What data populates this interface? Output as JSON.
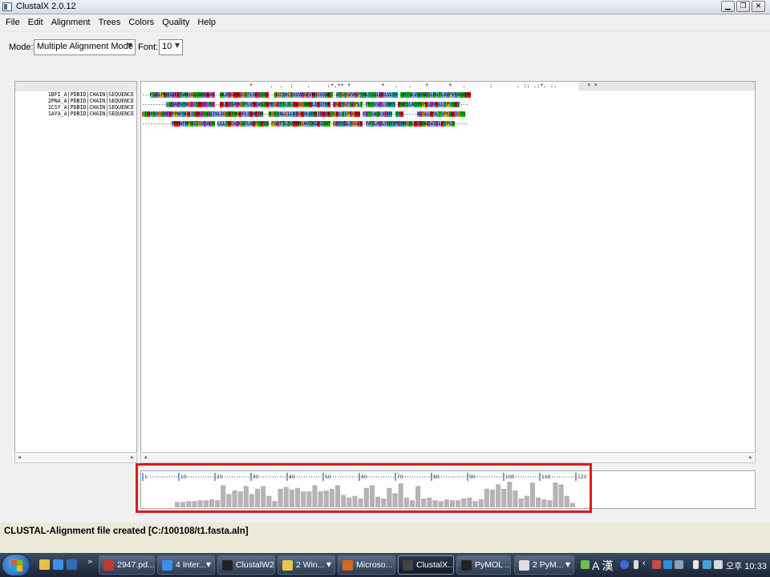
{
  "window": {
    "title": "ClustalX 2.0.12"
  },
  "menu": [
    "File",
    "Edit",
    "Alignment",
    "Trees",
    "Colors",
    "Quality",
    "Help"
  ],
  "toolbar": {
    "mode_label": "Mode:",
    "mode_value": "Multiple Alignment Mode",
    "font_label": "Font:",
    "font_value": "10"
  },
  "alignment": {
    "consensus": "                                *     .  .  :    .     :*.** *         *   .   .    *      *   .       :       . :: .:*. :.         * *",
    "sequences": [
      {
        "name": "1BFI_A|PDBID|CHAIN|SEQUENCE",
        "residues": "---MSDLPKHIDEKTWNVGSSNHDKAE--NLAEGKRDGTFLVRESSK--QGCYACSVVVDGEVKHCVINKT-ATGYGFAEPYNLYSSLKELVLHY-QHTSLVQHNDSLNVTLAYPVYAQQRR"
      },
      {
        "name": "2PNA_A|PDBID|CHAIN|SEQUENCE",
        "residues": "---------LQDAEWYWGDISREEVNE--KLRDTADGTFLVRDASTKMHGDYTLTLRKGGNNKLIKIFHR-DGKYGFSDPLT-FNSVVELINHY-RNESLAQYNPKLDVKLLYPVSKY---"
      },
      {
        "name": "1CSY_A|PDBID|CHAIN|SEQUENCE",
        "residues": "GSRASVGSHEKMPWFHGKISREESEQIVLIGSKTNGKFLIRARDN--NGSYALCLLHEGKVLHYRIDKDKTGKLSIPEGKK-FDTLWQLVEHY-SYK-----ADGLLRVLTVPCQKIGTQ"
      },
      {
        "name": "1AYA_A|PDBID|CHAIN|SEQUENCE",
        "residues": "-----------MRRWFHPNITGVEAEN-LLLTRGVDGSFLARPSKSN-PGDFTLSVRRNGAVTHIKIQNT-GDYYDLYGGEK-FATLAELVQYYMEHHGQLKEKNGDVIELKYPLN-----"
      }
    ]
  },
  "ruler_labels": [
    "1",
    "10",
    "20",
    "30",
    "40",
    "50",
    "60",
    "70",
    "80",
    "90",
    "100",
    "110",
    "120"
  ],
  "quality_scores": [
    6,
    6,
    7,
    7,
    8,
    8,
    9,
    8,
    25,
    15,
    19,
    18,
    24,
    15,
    21,
    24,
    13,
    7,
    21,
    23,
    20,
    22,
    18,
    18,
    25,
    18,
    19,
    21,
    25,
    14,
    11,
    13,
    10,
    22,
    25,
    12,
    10,
    22,
    16,
    27,
    11,
    8,
    24,
    10,
    11,
    8,
    7,
    9,
    8,
    8,
    10,
    11,
    7,
    9,
    21,
    20,
    26,
    21,
    29,
    19,
    10,
    13,
    28,
    11,
    9,
    8,
    28,
    26,
    13,
    5
  ],
  "status": "CLUSTAL-Alignment file created  [C:/100108/t1.fasta.aln]",
  "taskbar": {
    "tasks": [
      {
        "label": "2947.pd...",
        "color": "#c0392b"
      },
      {
        "label": "4 Inter...",
        "color": "#3d8ee6",
        "dropdown": true
      },
      {
        "label": "ClustalW2",
        "color": "#222222"
      },
      {
        "label": "2 Win...",
        "color": "#e8c64a",
        "dropdown": true
      },
      {
        "label": "Microso...",
        "color": "#d2691e"
      },
      {
        "label": "ClustalX...",
        "color": "#444444",
        "active": true
      },
      {
        "label": "PyMOL ...",
        "color": "#222222"
      },
      {
        "label": "2 PyM...",
        "color": "#dddddd",
        "dropdown": true
      }
    ],
    "tray": {
      "ime_label": "A 漢",
      "clock": "오후 10:33"
    }
  },
  "colors": {
    "highlight": "#e0191e",
    "quality_bar": "#b4b4b4",
    "residue": {
      "A": "#80a0f0",
      "I": "#80a0f0",
      "L": "#80a0f0",
      "M": "#80a0f0",
      "F": "#80a0f0",
      "W": "#80a0f0",
      "V": "#80a0f0",
      "C": "#f08080",
      "K": "#f01505",
      "R": "#f01505",
      "E": "#c048c0",
      "D": "#c048c0",
      "N": "#15c015",
      "Q": "#15c015",
      "S": "#15c015",
      "T": "#15c015",
      "G": "#f09048",
      "P": "#c0c000",
      "H": "#15a4a4",
      "Y": "#15a4a4"
    }
  }
}
